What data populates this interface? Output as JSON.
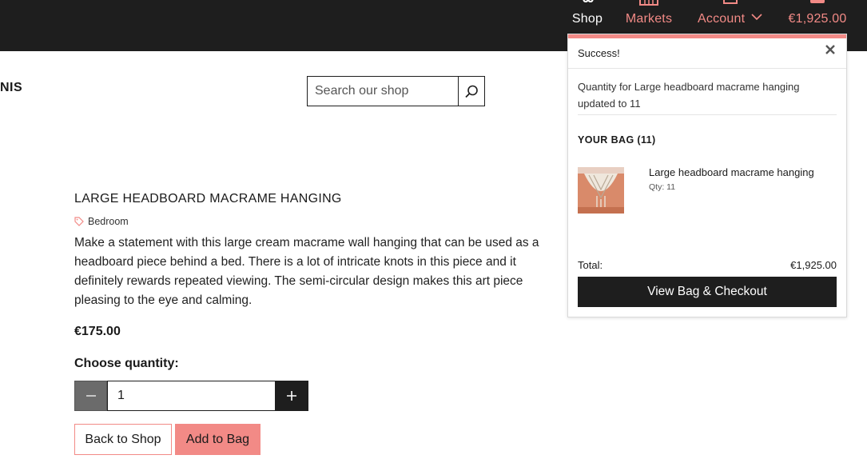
{
  "nav": {
    "shop": "Shop",
    "markets": "Markets",
    "account": "Account",
    "cart_total": "€1,925.00",
    "icons": [
      "shop-icon",
      "markets-icon",
      "account-icon",
      "cart-icon",
      "chevron-down-icon"
    ]
  },
  "brand": {
    "fragment": "NIS"
  },
  "search": {
    "placeholder": "Search our shop",
    "icon": "search-icon"
  },
  "product": {
    "title": "LARGE HEADBOARD MACRAME HANGING",
    "category": "Bedroom",
    "category_icon": "tag-icon",
    "description": "Make a statement with this large cream macrame wall hanging that can be used as a headboard piece behind a bed. There is a lot of intricate knots in this piece and it definitely rewards repeated viewing. The semi-circular design makes this art piece pleasing to the eye and calming.",
    "price": "€175.00",
    "quantity_label": "Choose quantity:",
    "quantity_value": "1",
    "back_label": "Back to Shop",
    "add_label": "Add to Bag"
  },
  "popup": {
    "title": "Success!",
    "message": "Quantity for Large headboard macrame hanging updated to 11",
    "bag_title": "YOUR BAG (11)",
    "item": {
      "name": "Large headboard macrame hanging",
      "qty": "Qty: 11"
    },
    "total_label": "Total:",
    "total_value": "€1,925.00",
    "checkout_label": "View Bag & Checkout"
  },
  "colors": {
    "accent": "#f28a86",
    "dark": "#1e1e1e",
    "minus_button": "#6b6b6b"
  }
}
